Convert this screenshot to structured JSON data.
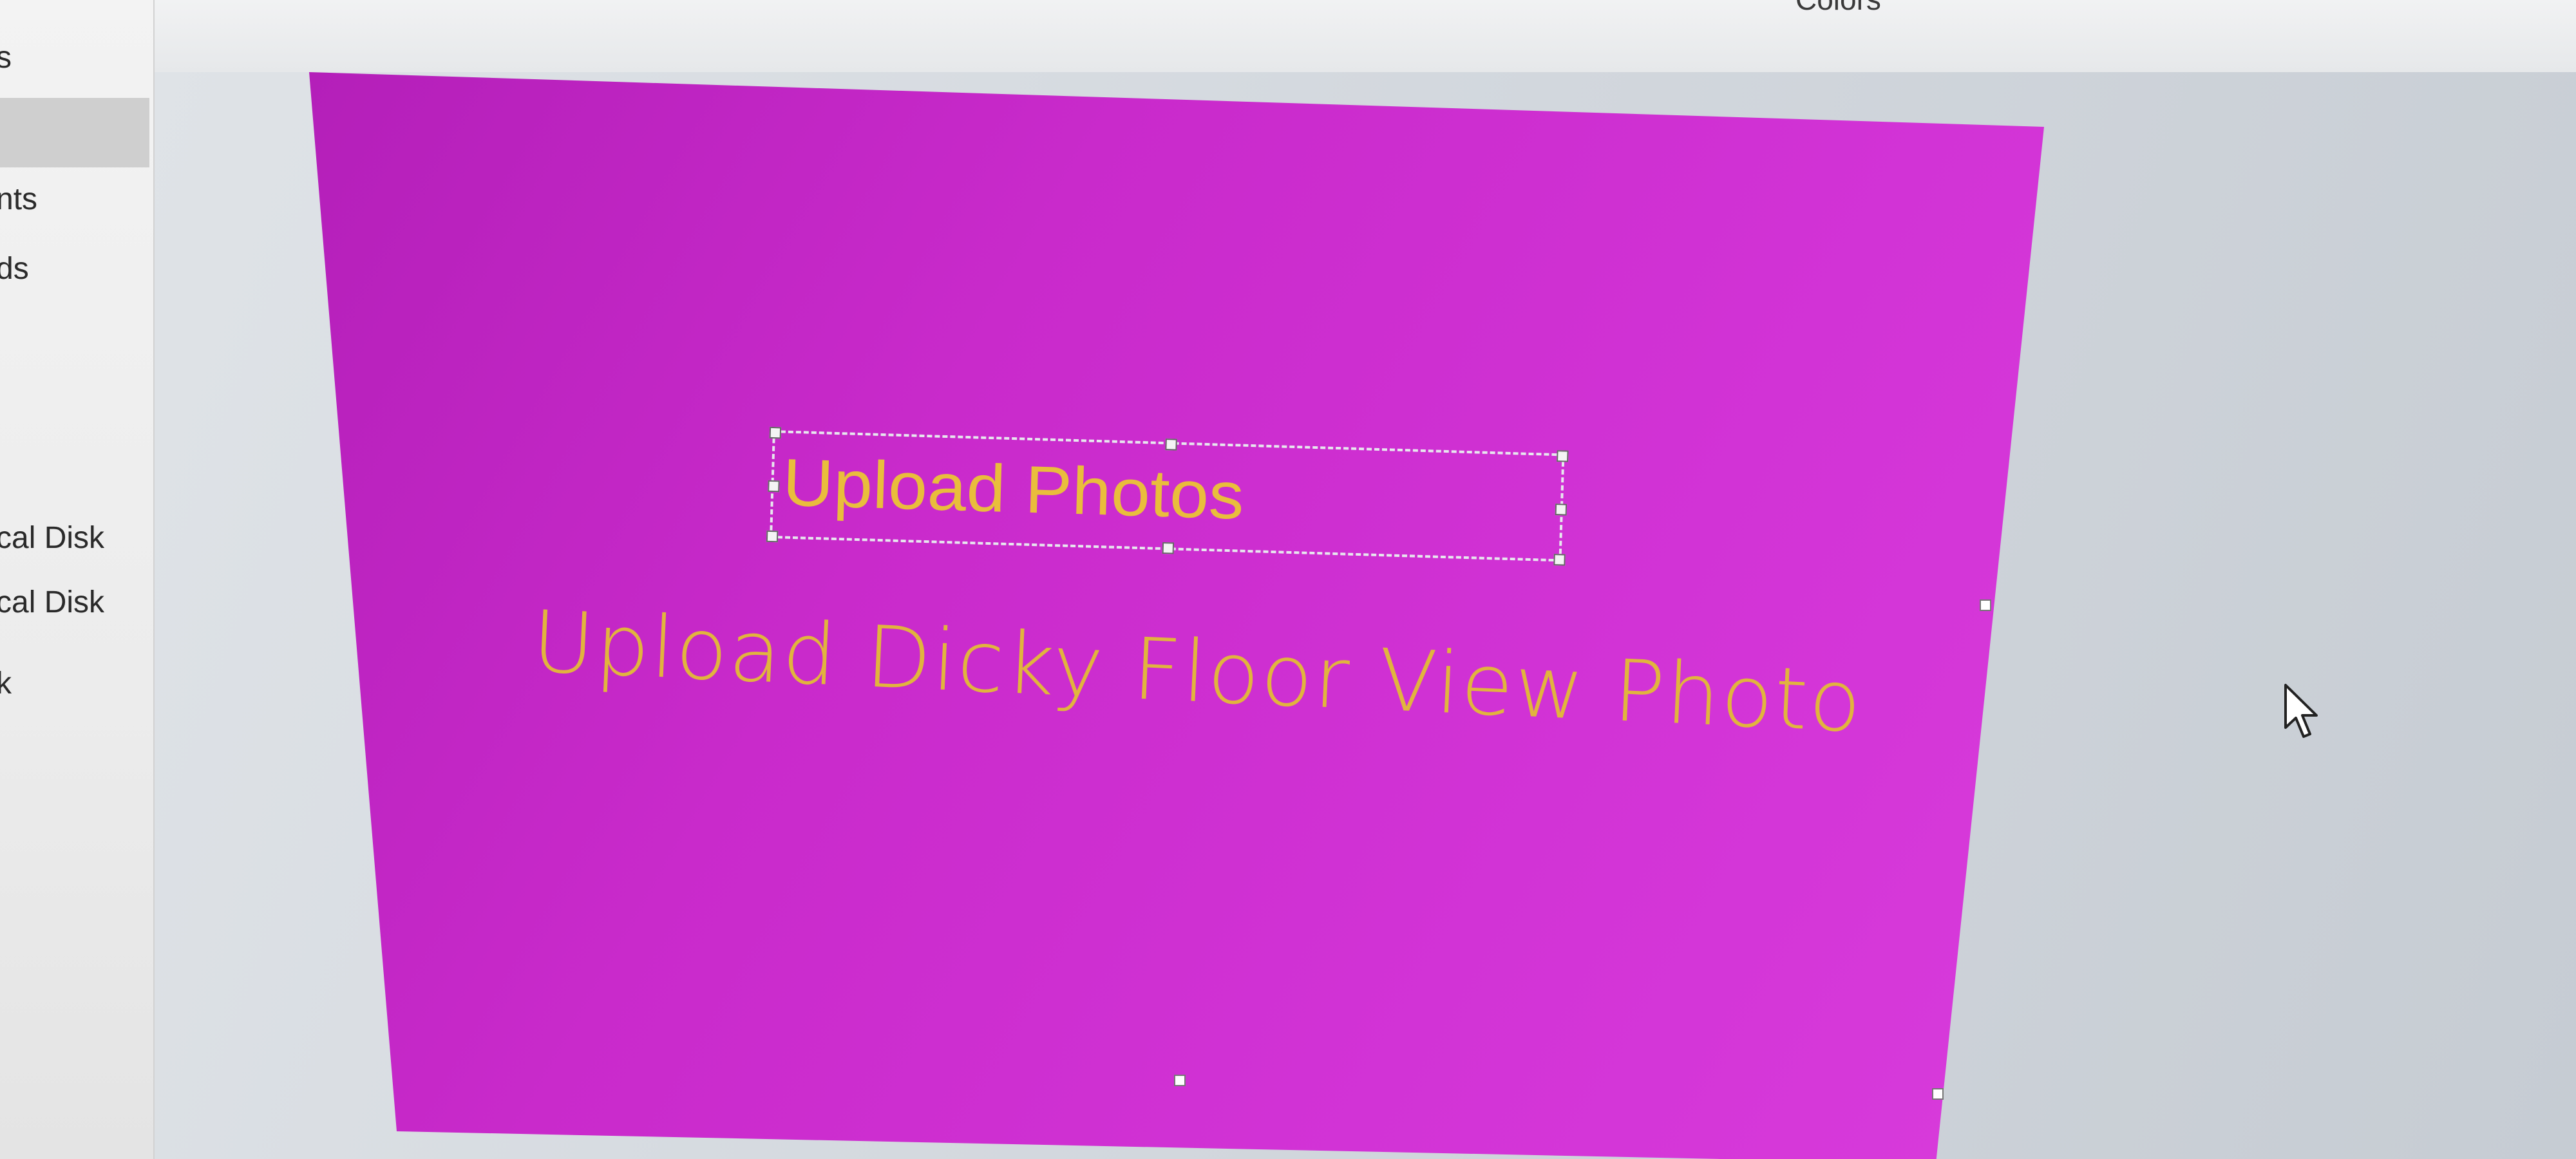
{
  "ribbon": {
    "colors_label": "Colors"
  },
  "nav_pane": {
    "items": [
      {
        "label": "s"
      },
      {
        "label": "nts"
      },
      {
        "label": "ds"
      },
      {
        "label": "cal Disk"
      },
      {
        "label": "cal Disk"
      },
      {
        "label": "k"
      }
    ],
    "selected_index": 1
  },
  "slide": {
    "background_color": "#cc2ccf",
    "title": "Upload Photos",
    "subtitle": "Upload Dicky Floor View Photo",
    "text_color": "#e9bd3c"
  },
  "icons": {
    "cursor": "mouse-pointer-icon"
  }
}
